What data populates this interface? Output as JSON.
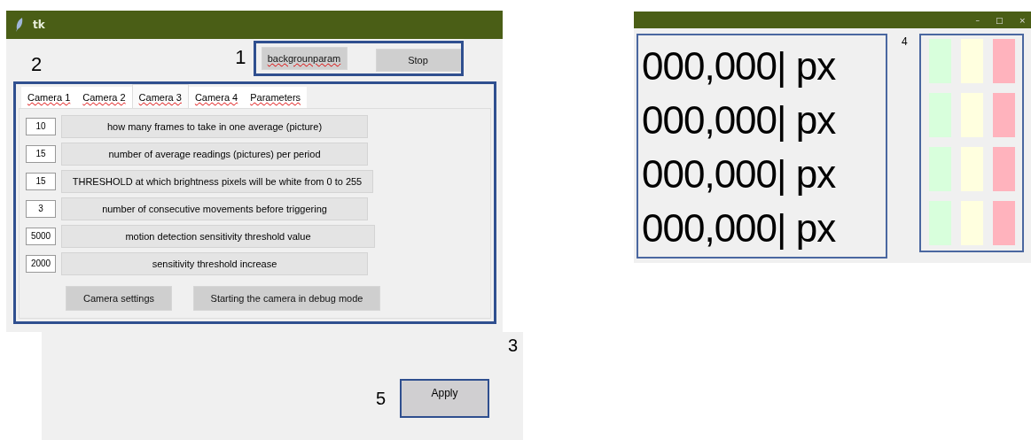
{
  "main_window": {
    "title": "tk",
    "callout_1": "1",
    "callout_2": "2",
    "top_buttons": [
      {
        "label": "backgrounparam",
        "misspelled": true
      },
      {
        "label": "Stop",
        "misspelled": false
      }
    ],
    "tabs": [
      {
        "label": "Camera 1",
        "selected": false,
        "misspelled": true
      },
      {
        "label": "Camera 2",
        "selected": false,
        "misspelled": true
      },
      {
        "label": "Camera 3",
        "selected": true,
        "misspelled": true
      },
      {
        "label": "Camera 4",
        "selected": false,
        "misspelled": true
      },
      {
        "label": "Parameters",
        "selected": false,
        "misspelled": true
      }
    ],
    "parameters": [
      {
        "value": "10",
        "label": "how many frames to take in one average (picture)"
      },
      {
        "value": "15",
        "label": "number of average readings (pictures) per period"
      },
      {
        "value": "15",
        "label": "THRESHOLD at which brightness pixels will be white from 0 to 255"
      },
      {
        "value": "3",
        "label": "number of consecutive movements before triggering"
      },
      {
        "value": "5000",
        "label": "motion detection sensitivity threshold value"
      },
      {
        "value": "2000",
        "label": "sensitivity threshold increase"
      }
    ],
    "bottom_buttons": [
      "Camera settings",
      "Starting the camera in debug mode"
    ]
  },
  "apply_panel": {
    "callout_3": "3",
    "callout_5": "5",
    "apply_button": "Apply"
  },
  "readout_window": {
    "controls": [
      "–",
      "□",
      "×"
    ],
    "readings": [
      "000,000| px",
      "000,000| px",
      "000,000| px",
      "000,000| px"
    ],
    "callout_4": "4",
    "lights": [
      [
        {
          "color": "#d8ffdc"
        },
        {
          "color": "#ffffdf"
        },
        {
          "color": "#ffb3bd"
        }
      ],
      [
        {
          "color": "#d8ffdc"
        },
        {
          "color": "#ffffdf"
        },
        {
          "color": "#ffb3bd"
        }
      ],
      [
        {
          "color": "#d8ffdc"
        },
        {
          "color": "#ffffdf"
        },
        {
          "color": "#ffb3bd"
        }
      ],
      [
        {
          "color": "#d8ffdc"
        },
        {
          "color": "#ffffdf"
        },
        {
          "color": "#ffb3bd"
        }
      ]
    ]
  }
}
